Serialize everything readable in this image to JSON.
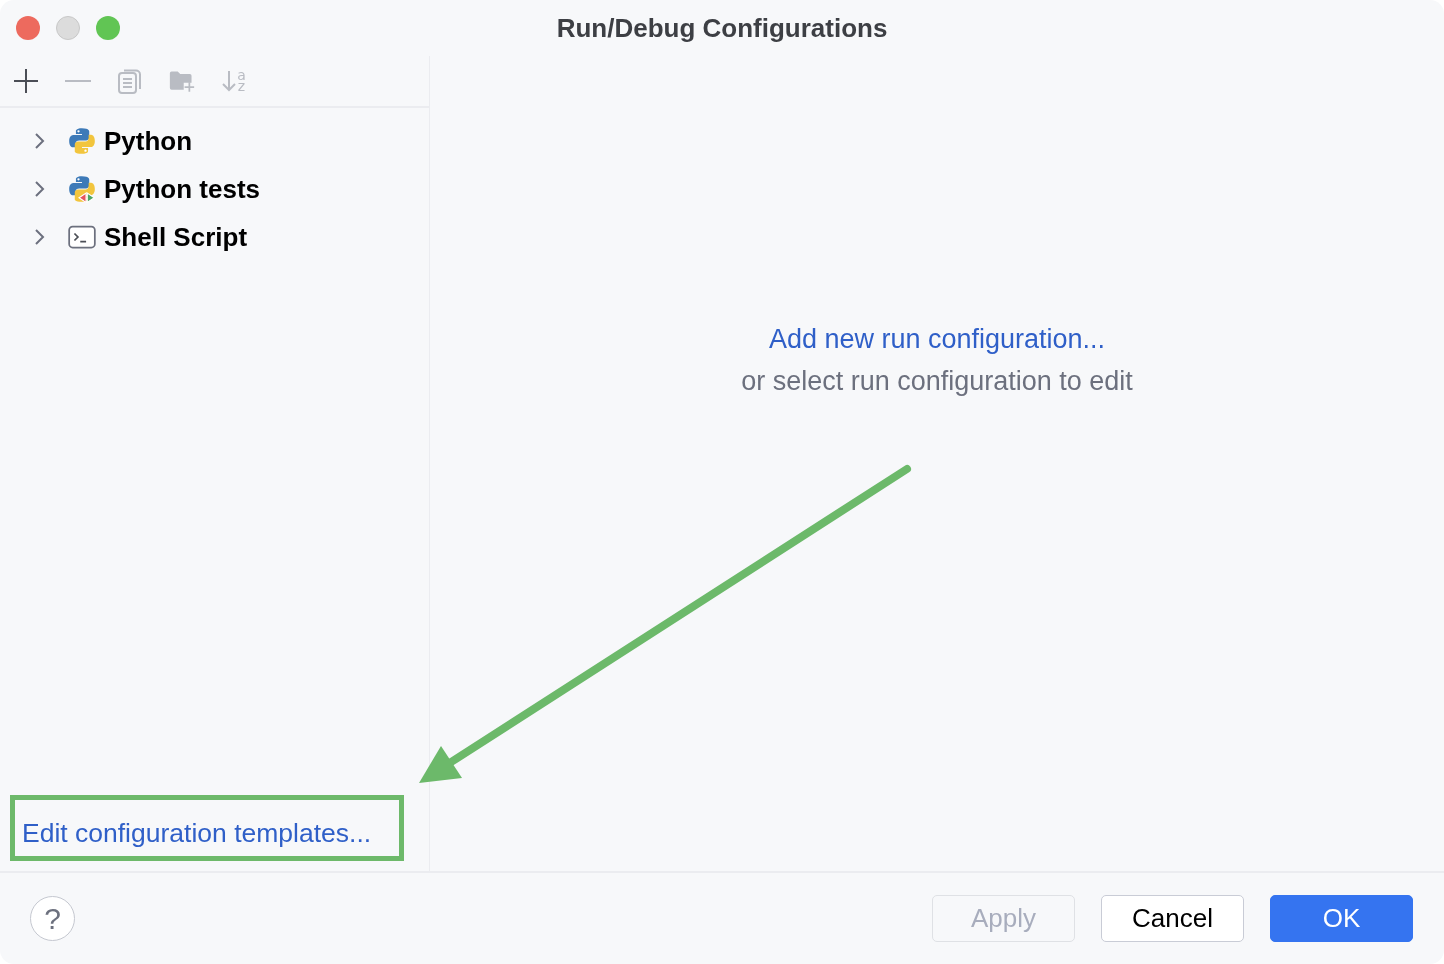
{
  "window": {
    "title": "Run/Debug Configurations",
    "controls": [
      {
        "kind": "close",
        "disabled": false
      },
      {
        "kind": "minimize",
        "disabled": true
      },
      {
        "kind": "zoom",
        "disabled": false
      }
    ]
  },
  "toolbar": [
    {
      "kind": "add",
      "disabled": false
    },
    {
      "kind": "remove",
      "disabled": true
    },
    {
      "kind": "copy",
      "disabled": true
    },
    {
      "kind": "folder",
      "disabled": true
    },
    {
      "kind": "sort",
      "disabled": true,
      "letters": [
        "a",
        "z"
      ]
    }
  ],
  "tree": [
    {
      "label": "Python",
      "kind": "python",
      "expanded": false
    },
    {
      "label": "Python tests",
      "kind": "python-tests",
      "expanded": false
    },
    {
      "label": "Shell Script",
      "kind": "shell",
      "expanded": false
    }
  ],
  "templates_link": {
    "label": "Edit configuration templates...",
    "highlighted": true
  },
  "empty_state": {
    "link": "Add new run configuration...",
    "hint": "or select run configuration to edit"
  },
  "help": "?",
  "buttons": [
    {
      "label": "Apply",
      "kind": "secondary",
      "disabled": true
    },
    {
      "label": "Cancel",
      "kind": "secondary",
      "disabled": false
    },
    {
      "label": "OK",
      "kind": "primary",
      "disabled": false
    }
  ]
}
